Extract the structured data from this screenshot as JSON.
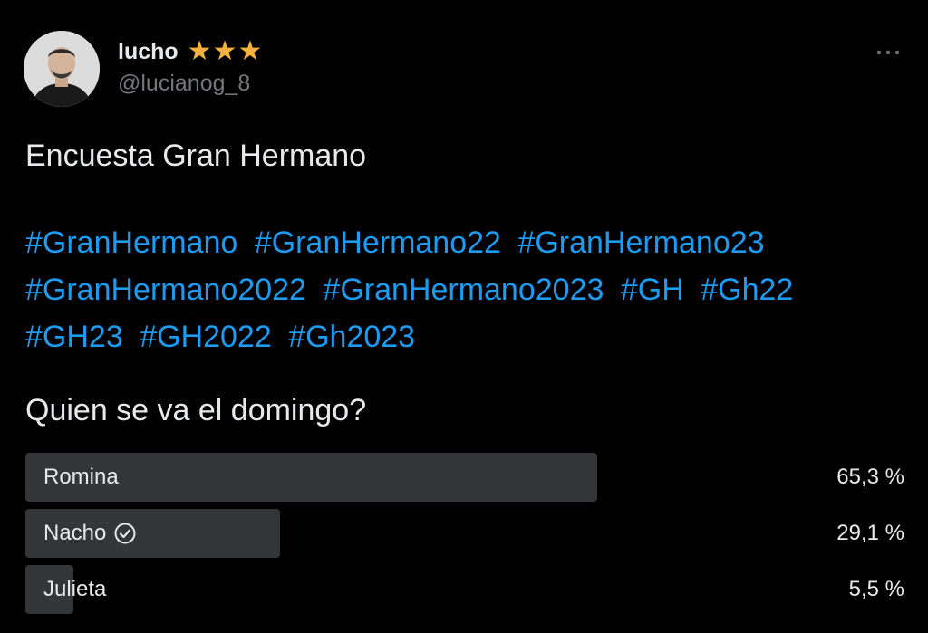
{
  "author": {
    "display_name": "lucho",
    "stars": "★★★",
    "handle": "@lucianog_8",
    "more_icon": "more-horizontal-icon"
  },
  "tweet": {
    "text": "Encuesta Gran Hermano",
    "hashtags": [
      "#GranHermano",
      "#GranHermano22",
      "#GranHermano23",
      "#GranHermano2022",
      "#GranHermano2023",
      "#GH",
      "#Gh22",
      "#GH23",
      "#GH2022",
      "#Gh2023"
    ]
  },
  "poll": {
    "question": "Quien se va el domingo?",
    "options": [
      {
        "label": "Romina",
        "percent": "65,3 %",
        "fraction": 0.653,
        "selected": false
      },
      {
        "label": "Nacho",
        "percent": "29,1 %",
        "fraction": 0.291,
        "selected": true
      },
      {
        "label": "Julieta",
        "percent": "5,5 %",
        "fraction": 0.055,
        "selected": false
      }
    ]
  },
  "colors": {
    "background": "#000000",
    "text": "#e7e9ea",
    "muted": "#71767b",
    "link": "#1d9bf0",
    "star": "#f4b13e",
    "bar": "#333639"
  }
}
